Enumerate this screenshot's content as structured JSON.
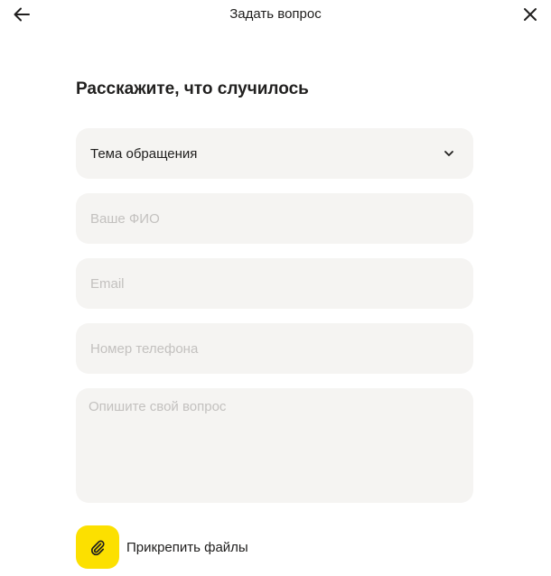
{
  "header": {
    "title": "Задать вопрос",
    "back_icon": "arrow-left-icon",
    "close_icon": "close-icon"
  },
  "form": {
    "title": "Расскажите, что случилось",
    "topic": {
      "selected_label": "Тема обращения",
      "icon": "chevron-down-icon"
    },
    "name": {
      "placeholder": "Ваше ФИО",
      "value": ""
    },
    "email": {
      "placeholder": "Email",
      "value": ""
    },
    "phone": {
      "placeholder": "Номер телефона",
      "value": ""
    },
    "question": {
      "placeholder": "Опишите свой вопрос",
      "value": ""
    },
    "attach": {
      "label": "Прикрепить файлы",
      "icon": "paperclip-icon"
    }
  },
  "colors": {
    "accent": "#fce000",
    "field_background": "#f5f4f2",
    "text": "#21201f",
    "placeholder": "#c3c1bf"
  }
}
